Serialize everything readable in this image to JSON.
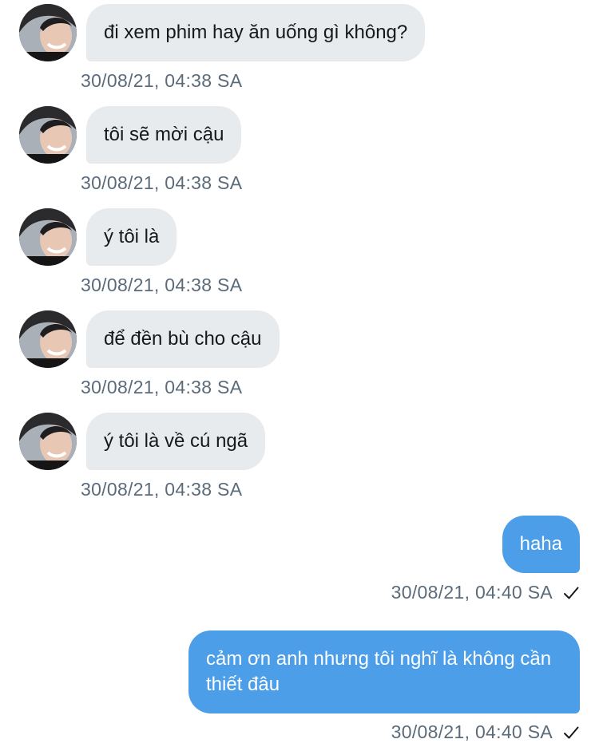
{
  "conversation": {
    "incoming": [
      {
        "text": "đi xem phim hay ăn uống gì không?",
        "time": "30/08/21, 04:38 SA"
      },
      {
        "text": "tôi sẽ mời cậu",
        "time": "30/08/21, 04:38 SA"
      },
      {
        "text": "ý tôi là",
        "time": "30/08/21, 04:38 SA"
      },
      {
        "text": "để đền bù cho cậu",
        "time": "30/08/21, 04:38 SA"
      },
      {
        "text": "ý tôi là về cú ngã",
        "time": "30/08/21, 04:38 SA"
      }
    ],
    "outgoing": [
      {
        "text": "haha",
        "time": "30/08/21, 04:40 SA"
      },
      {
        "text": "cảm ơn anh nhưng tôi nghĩ là không cần thiết đâu",
        "time": "30/08/21, 04:40 SA"
      }
    ]
  },
  "colors": {
    "incoming_bubble": "#e8ebee",
    "outgoing_bubble": "#4c9ee8",
    "timestamp": "#5b6b7a"
  },
  "icons": {
    "avatar": "avatar-photo",
    "read_receipt": "check-icon"
  }
}
